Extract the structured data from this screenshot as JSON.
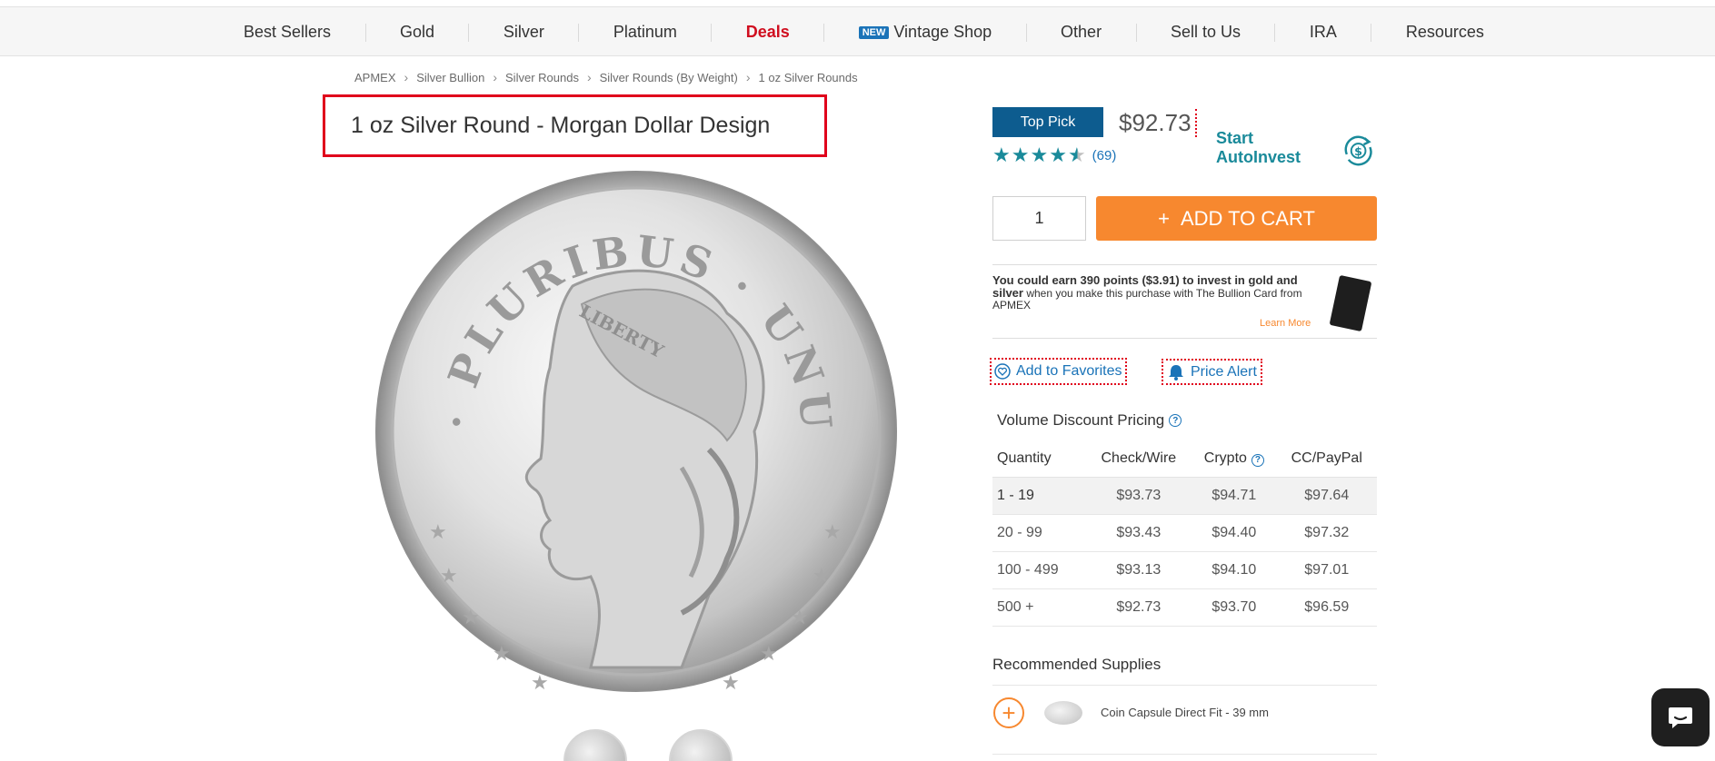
{
  "nav": {
    "items": [
      {
        "label": "Best Sellers"
      },
      {
        "label": "Gold"
      },
      {
        "label": "Silver"
      },
      {
        "label": "Platinum"
      },
      {
        "label": "Deals"
      },
      {
        "label": "Vintage Shop",
        "badge": "NEW"
      },
      {
        "label": "Other"
      },
      {
        "label": "Sell to Us"
      },
      {
        "label": "IRA"
      },
      {
        "label": "Resources"
      }
    ],
    "deals_color": "#d00e1f"
  },
  "breadcrumb": [
    "APMEX",
    "Silver Bullion",
    "Silver Rounds",
    "Silver Rounds (By Weight)",
    "1 oz Silver Rounds"
  ],
  "product": {
    "title": "1 oz Silver Round - Morgan Dollar Design",
    "badge": "Top Pick",
    "price": "$92.73",
    "rating": 4.5,
    "review_count": "(69)",
    "autoinvest_label": "Start AutoInvest",
    "quantity": "1",
    "add_to_cart_label": "ADD TO CART",
    "coin_legend": "E · PLURIBUS · UNUM",
    "coin_headband": "LIBERTY"
  },
  "points": {
    "text_bold": "You could earn 390 points ($3.91) to invest in gold and silver",
    "text_rest": " when you make this purchase with The Bullion Card from APMEX",
    "learn_more": "Learn More"
  },
  "actions": {
    "favorites": "Add to Favorites",
    "price_alert": "Price Alert"
  },
  "volume_discount": {
    "title": "Volume Discount Pricing",
    "headers": [
      "Quantity",
      "Check/Wire",
      "Crypto",
      "CC/PayPal"
    ],
    "rows": [
      [
        "1 - 19",
        "$93.73",
        "$94.71",
        "$97.64"
      ],
      [
        "20 - 99",
        "$93.43",
        "$94.40",
        "$97.32"
      ],
      [
        "100 - 499",
        "$93.13",
        "$94.10",
        "$97.01"
      ],
      [
        "500 +",
        "$92.73",
        "$93.70",
        "$96.59"
      ]
    ]
  },
  "recommended": {
    "title": "Recommended Supplies",
    "items": [
      {
        "name": "Coin Capsule Direct Fit - 39 mm"
      }
    ]
  },
  "colors": {
    "accent_orange": "#f7882f",
    "brand_blue": "#0d5c8f",
    "highlight_red": "#e0001b",
    "teal": "#1a8a9a"
  }
}
